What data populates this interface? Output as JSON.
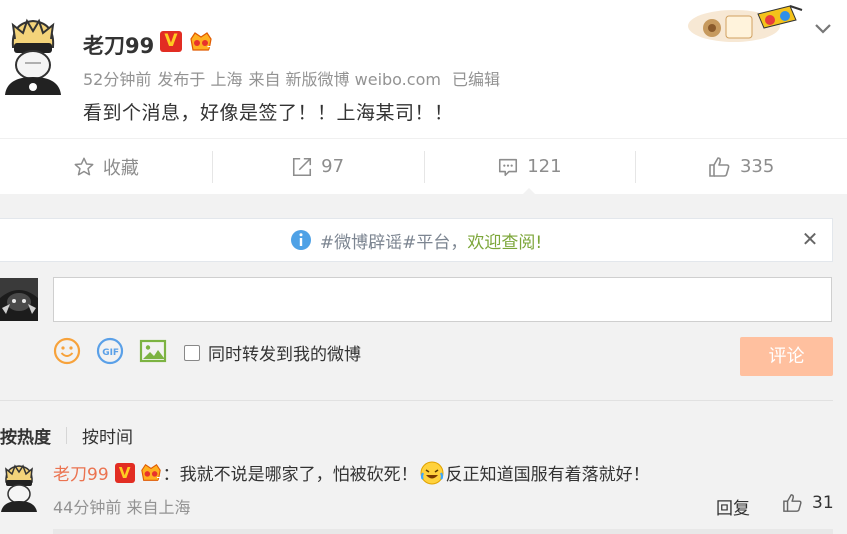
{
  "post": {
    "author": "老刀99",
    "time": "52分钟前",
    "published_in": "发布于 上海",
    "source": "来自 新版微博 weibo.com",
    "edited": "已编辑",
    "text": "看到个消息，好像是签了！！上海某司！！"
  },
  "actions": {
    "favorite_label": "收藏",
    "repost_count": "97",
    "comment_count": "121",
    "like_count": "335"
  },
  "notice": {
    "text": "#微博辟谣#平台，",
    "link": "欢迎查阅!"
  },
  "composer": {
    "input_value": "",
    "repost_label": "同时转发到我的微博",
    "submit_label": "评论"
  },
  "sort": {
    "hot_label": "按热度",
    "time_label": "按时间"
  },
  "comment": {
    "author": "老刀99",
    "text_before": "：我就不说是哪家了，怕被砍死！",
    "text_after": "反正知道国服有着落就好！",
    "meta": "44分钟前 来自上海",
    "reply_label": "回复",
    "like_count": "31"
  },
  "badges": {
    "verified": "V"
  },
  "colors": {
    "accent_orange": "#eb7350",
    "submit_disabled": "#ffc09f",
    "link_green": "#7ca639",
    "verified_red": "#e22d23"
  }
}
